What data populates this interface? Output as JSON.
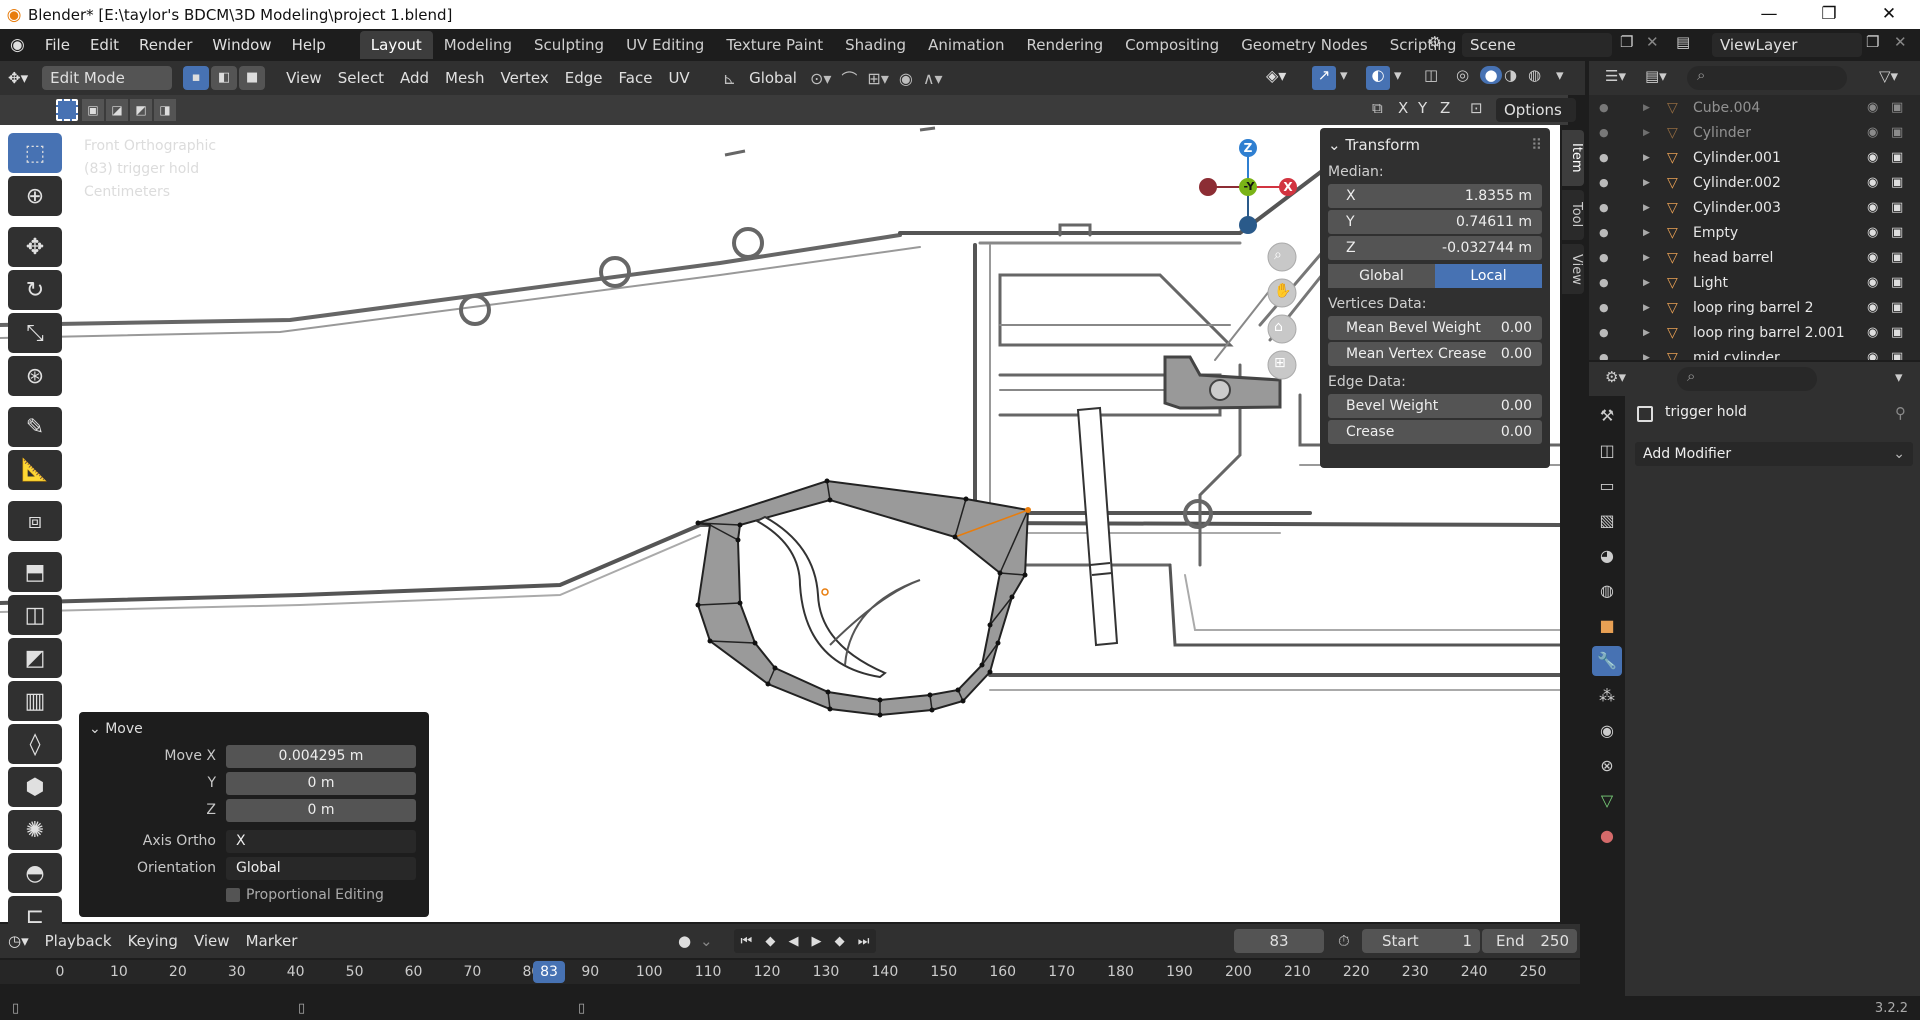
{
  "window": {
    "title": "Blender* [E:\\taylor's BDCM\\3D Modeling\\project 1.blend]"
  },
  "menus": [
    "File",
    "Edit",
    "Render",
    "Window",
    "Help"
  ],
  "workspaces": [
    "Layout",
    "Modeling",
    "Sculpting",
    "UV Editing",
    "Texture Paint",
    "Shading",
    "Animation",
    "Rendering",
    "Compositing",
    "Geometry Nodes",
    "Scripting"
  ],
  "scene": {
    "name": "Scene",
    "view_layer": "ViewLayer"
  },
  "viewport_header": {
    "mode": "Edit Mode",
    "menus": [
      "View",
      "Select",
      "Add",
      "Mesh",
      "Vertex",
      "Edge",
      "Face",
      "UV"
    ],
    "orientation": "Global",
    "options": "Options",
    "axes": [
      "X",
      "Y",
      "Z"
    ]
  },
  "viewport_info": {
    "view": "Front Orthographic",
    "object": "(83) trigger hold",
    "units": "Centimeters"
  },
  "gizmo": {
    "z": "Z",
    "y": "-Y",
    "x": "X"
  },
  "side_tabs": [
    "Item",
    "Tool",
    "View"
  ],
  "transform_panel": {
    "title": "Transform",
    "median_label": "Median:",
    "median": [
      {
        "axis": "X",
        "value": "1.8355 m"
      },
      {
        "axis": "Y",
        "value": "0.74611 m"
      },
      {
        "axis": "Z",
        "value": "-0.032744 m"
      }
    ],
    "space_global": "Global",
    "space_local": "Local",
    "vertices_label": "Vertices Data:",
    "vertices": [
      {
        "name": "Mean Bevel Weight",
        "value": "0.00"
      },
      {
        "name": "Mean Vertex Crease",
        "value": "0.00"
      }
    ],
    "edge_label": "Edge Data:",
    "edges": [
      {
        "name": "Bevel Weight",
        "value": "0.00"
      },
      {
        "name": "Crease",
        "value": "0.00"
      }
    ]
  },
  "move_panel": {
    "title": "Move",
    "rows": [
      {
        "key": "Move X",
        "value": "0.004295 m"
      },
      {
        "key": "Y",
        "value": "0 m"
      },
      {
        "key": "Z",
        "value": "0 m"
      }
    ],
    "axis_ortho_label": "Axis Ortho",
    "axis_ortho_value": "X",
    "orientation_label": "Orientation",
    "orientation_value": "Global",
    "proportional_label": "Proportional Editing"
  },
  "outliner": [
    {
      "name": "Cube.004",
      "dim": true
    },
    {
      "name": "Cylinder",
      "dim": true
    },
    {
      "name": "Cylinder.001",
      "dim": false
    },
    {
      "name": "Cylinder.002",
      "dim": false
    },
    {
      "name": "Cylinder.003",
      "dim": false
    },
    {
      "name": "Empty",
      "dim": false
    },
    {
      "name": "head barrel",
      "dim": false
    },
    {
      "name": "Light",
      "dim": false
    },
    {
      "name": "loop ring barrel 2",
      "dim": false
    },
    {
      "name": "loop ring barrel 2.001",
      "dim": false
    },
    {
      "name": "mid cylinder",
      "dim": false
    }
  ],
  "properties": {
    "object_name": "trigger hold",
    "add_modifier": "Add Modifier"
  },
  "timeline": {
    "menus": [
      "Playback",
      "Keying",
      "View",
      "Marker"
    ],
    "current_frame": "83",
    "start_label": "Start",
    "start": "1",
    "end_label": "End",
    "end": "250",
    "ruler": [
      "0",
      "10",
      "20",
      "30",
      "40",
      "50",
      "60",
      "70",
      "80",
      "90",
      "100",
      "110",
      "120",
      "130",
      "140",
      "150",
      "160",
      "170",
      "180",
      "190",
      "200",
      "210",
      "220",
      "230",
      "240",
      "250"
    ]
  },
  "status": {
    "version": "3.2.2"
  }
}
